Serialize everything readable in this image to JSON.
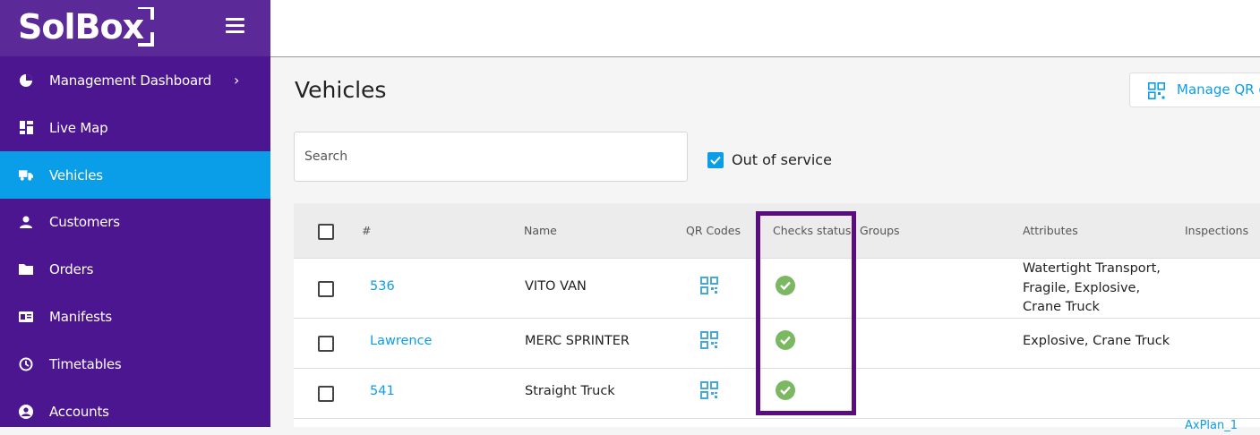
{
  "brand": {
    "logo_text": "SolBox"
  },
  "sidebar": {
    "items": [
      {
        "label": "Management Dashboard",
        "icon": "pie-chart-icon",
        "has_chevron": true
      },
      {
        "label": "Live Map",
        "icon": "dashboard-icon"
      },
      {
        "label": "Vehicles",
        "icon": "truck-icon",
        "active": true
      },
      {
        "label": "Customers",
        "icon": "person-icon"
      },
      {
        "label": "Orders",
        "icon": "folder-icon"
      },
      {
        "label": "Manifests",
        "icon": "id-card-icon"
      },
      {
        "label": "Timetables",
        "icon": "clock-icon"
      },
      {
        "label": "Accounts",
        "icon": "account-circle-icon"
      }
    ]
  },
  "page": {
    "title": "Vehicles",
    "manage_button": "Manage QR c",
    "search_placeholder": "Search",
    "out_of_service_label": "Out of service",
    "out_of_service_checked": true
  },
  "table": {
    "headers": [
      "#",
      "Name",
      "QR Codes",
      "Checks status",
      "Groups",
      "Attributes",
      "Inspections"
    ],
    "rows": [
      {
        "id": "536",
        "name": "VITO VAN",
        "checks": "ok",
        "groups": "",
        "attributes": "Watertight Transport, Fragile, Explosive, Crane Truck"
      },
      {
        "id": "Lawrence",
        "name": "MERC SPRINTER",
        "checks": "ok",
        "groups": "",
        "attributes": "Explosive, Crane Truck"
      },
      {
        "id": "541",
        "name": "Straight Truck",
        "checks": "ok",
        "groups": "",
        "attributes": ""
      }
    ],
    "partial_footer_text": "AxPlan_1"
  },
  "colors": {
    "sidebar_bg": "#4b1690",
    "active_item": "#0a9ee8",
    "highlight_border": "#5b0d7f",
    "check_green": "#7cb862"
  }
}
